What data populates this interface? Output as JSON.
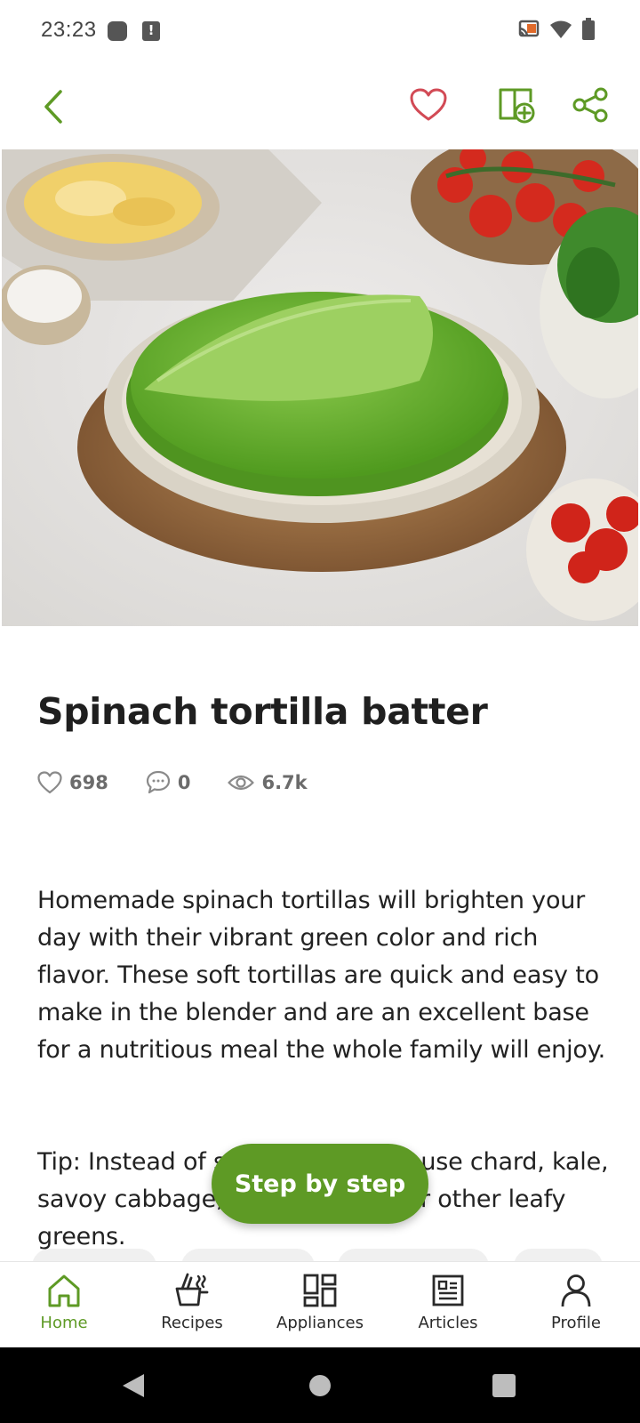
{
  "status_bar": {
    "time": "23:23"
  },
  "header": {
    "back_icon": "chevron-left-icon",
    "favorite_icon": "heart-icon",
    "add_to_collection_icon": "add-to-book-icon",
    "share_icon": "share-icon"
  },
  "recipe": {
    "title": "Spinach tortilla batter",
    "likes": "698",
    "comments": "0",
    "views": "6.7k",
    "description_paragraphs": [
      "Homemade spinach tortillas will brighten your day with their vibrant green color and rich flavor. These soft tortillas are quick and easy to make in the blender and are an excellent base for a nutritious meal the whole family will enjoy.",
      "Tip: Instead of spinach, you can use chard, kale, savoy cabbage, collard greens or other leafy greens."
    ]
  },
  "cta": {
    "label": "Step by step"
  },
  "bottom_nav": {
    "items": [
      {
        "label": "Home",
        "icon": "home-icon",
        "active": true
      },
      {
        "label": "Recipes",
        "icon": "recipes-pot-icon",
        "active": false
      },
      {
        "label": "Appliances",
        "icon": "appliances-grid-icon",
        "active": false
      },
      {
        "label": "Articles",
        "icon": "articles-newspaper-icon",
        "active": false
      },
      {
        "label": "Profile",
        "icon": "profile-person-icon",
        "active": false
      }
    ]
  },
  "colors": {
    "accent": "#5e9a25",
    "favorite": "#d24a55",
    "muted": "#6b6b6b"
  }
}
